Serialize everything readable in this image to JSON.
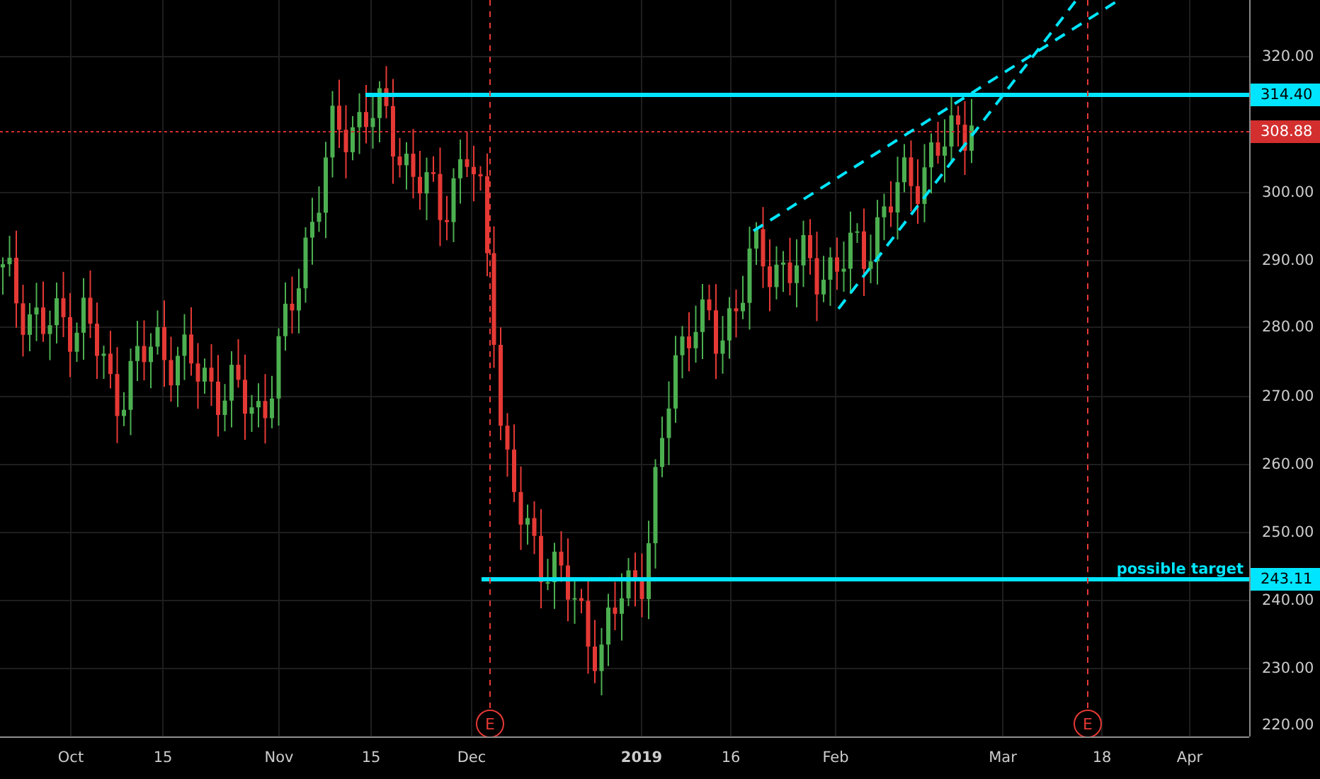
{
  "chart": {
    "y_axis_ticks": [
      "320.00",
      "300.00",
      "290.00",
      "280.00",
      "270.00",
      "260.00",
      "250.00",
      "240.00",
      "230.00",
      "220.00"
    ],
    "x_axis_labels": [
      {
        "label": "Oct",
        "bold": false
      },
      {
        "label": "15",
        "bold": false
      },
      {
        "label": "Nov",
        "bold": false
      },
      {
        "label": "15",
        "bold": false
      },
      {
        "label": "Dec",
        "bold": false
      },
      {
        "label": "2019",
        "bold": true
      },
      {
        "label": "16",
        "bold": false
      },
      {
        "label": "Feb",
        "bold": false
      },
      {
        "label": "Mar",
        "bold": false
      },
      {
        "label": "18",
        "bold": false
      },
      {
        "label": "Apr",
        "bold": false
      }
    ],
    "price_tags": [
      {
        "label": "314.40",
        "color": "#00e5ff"
      },
      {
        "label": "308.88",
        "color": "#d32f2f"
      },
      {
        "label": "243.11",
        "color": "#00e5ff"
      }
    ],
    "annotation": "possible target",
    "event_markers": [
      "E",
      "E"
    ]
  }
}
